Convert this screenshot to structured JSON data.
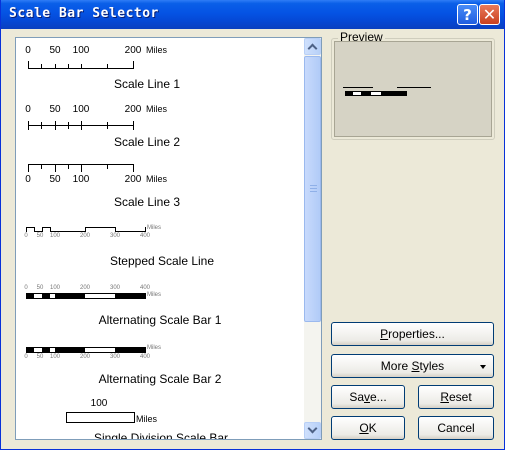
{
  "window": {
    "title": "Scale Bar Selector"
  },
  "title_buttons": {
    "help": "?",
    "close": "✕"
  },
  "styles": [
    {
      "name": "Scale Line 1",
      "ticks": [
        "0",
        "50",
        "100",
        "200"
      ],
      "unit": "Miles"
    },
    {
      "name": "Scale Line 2",
      "ticks": [
        "0",
        "50",
        "100",
        "200"
      ],
      "unit": "Miles"
    },
    {
      "name": "Scale Line 3",
      "ticks": [
        "0",
        "50",
        "100",
        "200"
      ],
      "unit": "Miles"
    },
    {
      "name": "Stepped Scale Line",
      "ticks": [
        "0",
        "50",
        "100",
        "200",
        "300",
        "400"
      ],
      "unit": "Miles"
    },
    {
      "name": "Alternating Scale Bar 1",
      "ticks": [
        "0",
        "50",
        "100",
        "200",
        "300",
        "400"
      ],
      "unit": "Miles"
    },
    {
      "name": "Alternating Scale Bar 2",
      "ticks": [
        "0",
        "50",
        "100",
        "200",
        "300",
        "400"
      ],
      "unit": "Miles"
    },
    {
      "name": "Single Division Scale Bar",
      "ticks": [
        "100"
      ],
      "unit": "Miles"
    }
  ],
  "preview": {
    "label": "Preview"
  },
  "buttons": {
    "properties": {
      "pre": "",
      "key": "P",
      "post": "roperties..."
    },
    "more_styles": {
      "pre": "More ",
      "key": "S",
      "post": "tyles"
    },
    "save": {
      "pre": "Sa",
      "key": "v",
      "post": "e..."
    },
    "reset": {
      "pre": "",
      "key": "R",
      "post": "eset"
    },
    "ok": {
      "pre": "",
      "key": "O",
      "post": "K"
    },
    "cancel": {
      "pre": "Cancel",
      "key": "",
      "post": ""
    }
  }
}
